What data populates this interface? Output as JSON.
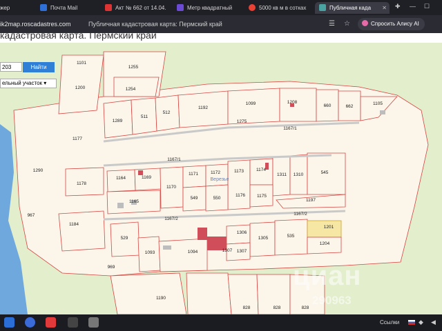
{
  "tabs": [
    {
      "label": "жер",
      "icon": "tab-icon"
    },
    {
      "label": "Почта Mail",
      "icon": "mail-icon"
    },
    {
      "label": "Акт № 662 от 14.04.",
      "icon": "pdf-icon"
    },
    {
      "label": "Метр квадратный",
      "icon": "ruler-icon"
    },
    {
      "label": "5000 кв м в сотках",
      "icon": "yandex-icon"
    },
    {
      "label": "Публичная када",
      "icon": "map-icon"
    }
  ],
  "address_bar": {
    "url": "ik2map.roscadastres.com",
    "page_title": "Публичная кадастровая карта: Пермский край",
    "alice_label": "Спросить Алису AI"
  },
  "header": {
    "title": "кадастровая карта. Пермский край"
  },
  "search": {
    "value": "203",
    "button_label": "Найти",
    "type_select": "ельный участок"
  },
  "map": {
    "parcels": [
      "1101",
      "1255",
      "1200",
      "1254",
      "1289",
      "511",
      "512",
      "1192",
      "1099",
      "1208",
      "660",
      "662",
      "1105",
      "1275",
      "1167/1",
      "1177",
      "1167/1",
      "1290",
      "1178",
      "1164",
      "1169",
      "1170",
      "1171",
      "1172",
      "1173",
      "1174",
      "1311",
      "1310",
      "545",
      "1165",
      "549",
      "550",
      "1176",
      "1175",
      "1197",
      "967",
      "1184",
      "1167/2",
      "1167/2",
      "1201",
      "529",
      "1093",
      "1094",
      "1306",
      "1305",
      "535",
      "1204",
      "1307",
      "969",
      "1190",
      "828",
      "828",
      "828",
      "1307"
    ],
    "village_label": "Верезье",
    "highlight_color": "#f6e7a4",
    "water_color": "#6fa8dc",
    "land_color": "#e3eecd",
    "parcel_fill": "#fbf5ea",
    "boundary_color": "#d64541"
  },
  "watermark": {
    "logo": "циан",
    "id": "290963"
  },
  "taskbar": {
    "links_label": "Ссылки",
    "lang": "RU"
  }
}
